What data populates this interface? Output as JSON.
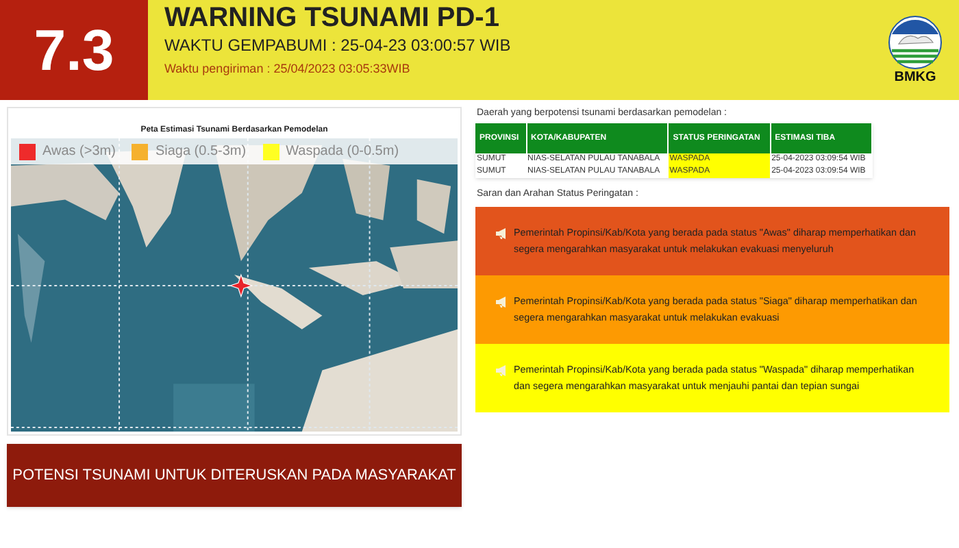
{
  "header": {
    "magnitude": "7.3",
    "title": "WARNING TSUNAMI PD-1",
    "quake_time": "WAKTU GEMPABUMI : 25-04-23 03:00:57 WIB",
    "sent_time": "Waktu pengiriman : 25/04/2023 03:05:33WIB",
    "logo_text": "BMKG"
  },
  "map": {
    "title": "Peta Estimasi Tsunami Berdasarkan Pemodelan",
    "legend": [
      {
        "label": "Awas (>3m)",
        "color": "#ee2b2b"
      },
      {
        "label": "Siaga (0.5-3m)",
        "color": "#f5b12e"
      },
      {
        "label": "Waspada (0-0.5m)",
        "color": "#ffff22"
      }
    ]
  },
  "forward_button": "POTENSI TSUNAMI UNTUK DITERUSKAN PADA MASYARAKAT",
  "table": {
    "caption": "Daerah yang berpotensi tsunami berdasarkan pemodelan :",
    "columns": [
      "PROVINSI",
      "KOTA/KABUPATEN",
      "STATUS PERINGATAN",
      "ESTIMASI TIBA"
    ],
    "rows": [
      {
        "cells": [
          "SUMUT",
          "NIAS-SELATAN PULAU TANABALA",
          "WASPADA",
          "25-04-2023 03:09:54 WIB"
        ],
        "color": "#ffff00"
      },
      {
        "cells": [
          "SUMUT",
          "NIAS-SELATAN PULAU TANABALA",
          "WASPADA",
          "25-04-2023 03:09:54 WIB"
        ],
        "color": "#ffff00"
      }
    ]
  },
  "advice": {
    "caption": "Saran dan Arahan Status Peringatan :",
    "items": [
      {
        "text": "Pemerintah Propinsi/Kab/Kota yang berada pada status \"Awas\" diharap memperhatikan dan segera mengarahkan masyarakat untuk melakukan evakuasi menyeluruh",
        "color": "#e2541c"
      },
      {
        "text": "Pemerintah Propinsi/Kab/Kota yang berada pada status \"Siaga\" diharap memperhatikan dan segera mengarahkan masyarakat untuk melakukan evakuasi",
        "color": "#fd9a02"
      },
      {
        "text": "Pemerintah Propinsi/Kab/Kota yang berada pada status \"Waspada\" diharap memperhatikan dan segera mengarahkan masyarakat untuk menjauhi pantai dan tepian sungai",
        "color": "#ffff00"
      }
    ]
  }
}
